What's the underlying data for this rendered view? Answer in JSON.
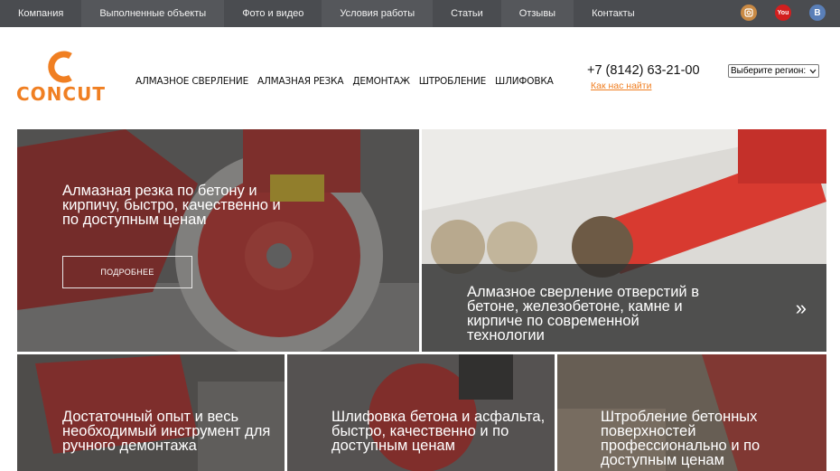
{
  "topbar": {
    "links": [
      "Компания",
      "Выполненные объекты",
      "Фото и видео",
      "Условия работы",
      "Статьи",
      "Отзывы",
      "Контакты"
    ],
    "socials": {
      "instagram_icon": "instagram-icon",
      "youtube_label": "You",
      "vk_label": "В"
    }
  },
  "header": {
    "logo_text": "CONCUT",
    "brand_color": "#f07f22",
    "nav": [
      "АЛМАЗНОЕ СВЕРЛЕНИЕ",
      "АЛМАЗНАЯ РЕЗКА",
      "ДЕМОНТАЖ",
      "ШТРОБЛЕНИЕ",
      "ШЛИФОВКА"
    ],
    "phone": "+7 (8142) 63-21-00",
    "how_to_find": "Как нас найти",
    "region_select": "Выберите регион:"
  },
  "tiles": [
    {
      "title": "Алмазная резка по бетону и кирпичу, быстро, качественно и по доступным ценам",
      "button": "ПОДРОБНЕЕ"
    },
    {
      "title": "Алмазное сверление отверстий в бетоне, железобетоне, камне и кирпиче по современной технологии",
      "arrow": "»"
    },
    {
      "title": "Достаточный опыт и весь необходимый инструмент для ручного демонтажа"
    },
    {
      "title": "Шлифовка бетона и асфальта, быстро, качественно и по доступным ценам"
    },
    {
      "title": "Штробление бетонных поверхностей профессионально и по доступным ценам"
    }
  ]
}
